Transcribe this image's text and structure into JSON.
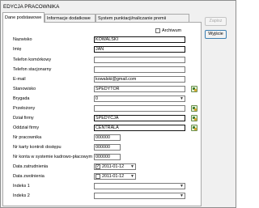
{
  "window": {
    "title": "EDYCJA PRACOWNIKA"
  },
  "tabs": [
    {
      "label": "Dane podstawowe"
    },
    {
      "label": "Informacje dodatkowe"
    },
    {
      "label": "System punktacji/naliczanie premii"
    }
  ],
  "buttons": {
    "save": "Zapisz",
    "exit": "Wyjście"
  },
  "archive": {
    "label": "Archiwum",
    "checked": false
  },
  "form": {
    "nazwisko": {
      "label": "Nazwisko",
      "value": "KOWALSKI"
    },
    "imie": {
      "label": "Imię",
      "value": "JAN"
    },
    "telefon_komorkowy": {
      "label": "Telefon komórkowy",
      "value": ""
    },
    "telefon_stacjonarny": {
      "label": "Telefon stacjonarny",
      "value": ""
    },
    "email": {
      "label": "E-mail",
      "value": "kowalski@gmail.com"
    },
    "stanowisko": {
      "label": "Stanowisko",
      "value": "SPEDYTOR"
    },
    "brygada": {
      "label": "Brygada",
      "value": "0"
    },
    "przelozony": {
      "label": "Przełożony",
      "value": ""
    },
    "dzial_firmy": {
      "label": "Dział firmy",
      "value": "SPEDYCJA"
    },
    "oddzial_firmy": {
      "label": "Oddział firmy",
      "value": "CENTRALA"
    },
    "nr_pracownika": {
      "label": "Nr pracownika",
      "value": "000000"
    },
    "nr_karty": {
      "label": "Nr karty kontroli dostępu",
      "value": "000000"
    },
    "nr_kadrowy": {
      "label": "Nr konta w systemie kadrowo-płacowym",
      "value": "000000"
    },
    "data_zatrudnienia": {
      "label": "Data zatrudnienia",
      "value": "2011-01-12",
      "checked": true
    },
    "data_zwolnienia": {
      "label": "Data zwolnienia",
      "value": "2011-01-12",
      "checked": false
    },
    "indeks1": {
      "label": "Indeks 1",
      "value": ""
    },
    "indeks2": {
      "label": "Indeks 2",
      "value": ""
    }
  },
  "glyphs": {
    "dropdown": "▼",
    "check": "✓"
  },
  "icons": {
    "browse": "lookup-icon"
  }
}
